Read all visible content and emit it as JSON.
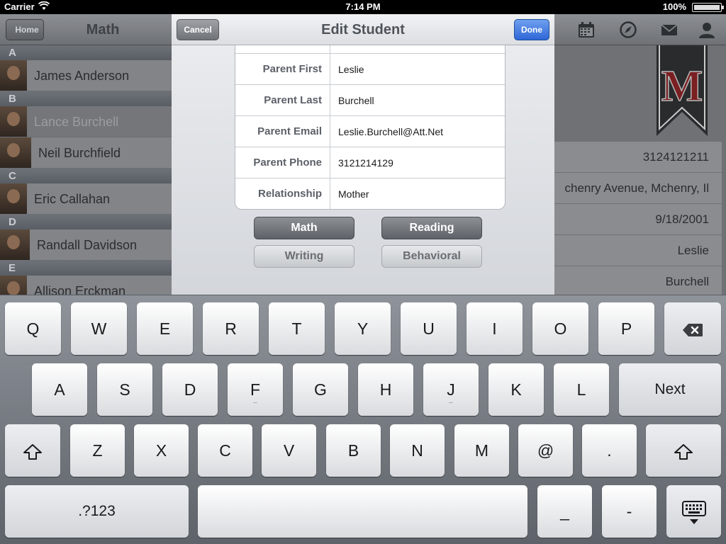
{
  "status_bar": {
    "carrier": "Carrier",
    "time": "7:14 PM",
    "battery": "100%"
  },
  "left_panel": {
    "home_label": "Home",
    "title": "Math",
    "sections": [
      {
        "letter": "A",
        "students": [
          "James Anderson"
        ]
      },
      {
        "letter": "B",
        "students": [
          "Lance Burchell",
          "Neil Burchfield"
        ]
      },
      {
        "letter": "C",
        "students": [
          "Eric Callahan"
        ]
      },
      {
        "letter": "D",
        "students": [
          "Randall Davidson"
        ]
      },
      {
        "letter": "E",
        "students": [
          "Allison Erckman"
        ]
      }
    ]
  },
  "right_panel": {
    "icons": [
      "calendar-icon",
      "compass-icon",
      "mail-icon",
      "person-icon"
    ],
    "ribbon_letter": "M",
    "fields": [
      "3124121211",
      "chenry Avenue, Mchenry, Il",
      "9/18/2001",
      "Leslie",
      "Burchell"
    ]
  },
  "modal": {
    "title": "Edit Student",
    "cancel_label": "Cancel",
    "done_label": "Done",
    "form_rows": [
      {
        "label": "Parent First",
        "value": "Leslie"
      },
      {
        "label": "Parent Last",
        "value": "Burchell"
      },
      {
        "label": "Parent Email",
        "value": "Leslie.Burchell@Att.Net"
      },
      {
        "label": "Parent Phone",
        "value": "3121214129"
      },
      {
        "label": "Relationship",
        "value": "Mother"
      }
    ],
    "category_buttons": {
      "math": "Math",
      "reading": "Reading",
      "writing": "Writing",
      "behavioral": "Behavioral"
    }
  },
  "keyboard": {
    "row1": [
      "Q",
      "W",
      "E",
      "R",
      "T",
      "Y",
      "U",
      "I",
      "O",
      "P"
    ],
    "row2": [
      "A",
      "S",
      "D",
      "F",
      "G",
      "H",
      "J",
      "K",
      "L"
    ],
    "next_label": "Next",
    "row3": [
      "Z",
      "X",
      "C",
      "V",
      "B",
      "N",
      "M",
      "@",
      "."
    ],
    "numbers_label": ".?123",
    "underscore_label": "_",
    "dash_label": "-"
  }
}
